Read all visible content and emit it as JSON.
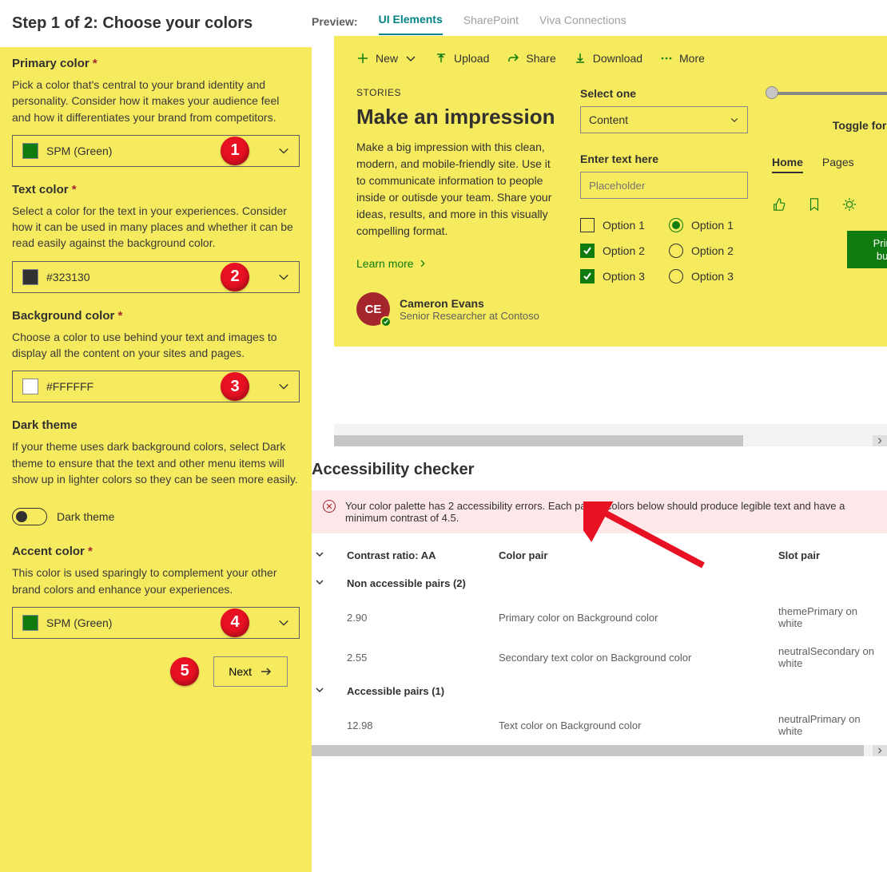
{
  "step_title": "Step 1 of 2: Choose your colors",
  "sections": {
    "primary": {
      "heading": "Primary color",
      "desc": "Pick a color that's central to your brand identity and personality. Consider how it makes your audience feel and how it differentiates your brand from competitors.",
      "value": "SPM (Green)",
      "swatch": "#107c10",
      "badge": "1"
    },
    "text": {
      "heading": "Text color",
      "desc": "Select a color for the text in your experiences. Consider how it can be used in many places and whether it can be read easily against the background color.",
      "value": "#323130",
      "swatch": "#323130",
      "badge": "2"
    },
    "background": {
      "heading": "Background color",
      "desc": "Choose a color to use behind your text and images to display all the content on your sites and pages.",
      "value": "#FFFFFF",
      "swatch": "#ffffff",
      "badge": "3"
    },
    "dark": {
      "heading": "Dark theme",
      "desc": "If your theme uses dark background colors, select Dark theme to ensure that the text and other menu items will show up in lighter colors so they can be seen more easily.",
      "toggle_label": "Dark theme"
    },
    "accent": {
      "heading": "Accent color",
      "desc": "This color is used sparingly to complement your other brand colors and enhance your experiences.",
      "value": "SPM (Green)",
      "swatch": "#107c10",
      "badge": "4"
    }
  },
  "next": {
    "label": "Next",
    "badge": "5"
  },
  "preview": {
    "label": "Preview:",
    "tabs": [
      "UI Elements",
      "SharePoint",
      "Viva Connections"
    ],
    "active_tab": 0,
    "cmd": {
      "new": "New",
      "upload": "Upload",
      "share": "Share",
      "download": "Download",
      "more": "More"
    },
    "stories": "STORIES",
    "impression_title": "Make an impression",
    "impression_body": "Make a big impression with this clean, modern, and mobile-friendly site. Use it to communicate information to people inside or outisde your team. Share your ideas, results, and more in this visually compelling format.",
    "learn_more": "Learn more",
    "persona": {
      "initials": "CE",
      "name": "Cameron Evans",
      "role": "Senior Researcher at Contoso"
    },
    "select_label": "Select one",
    "select_value": "Content",
    "enter_label": "Enter text here",
    "placeholder": "Placeholder",
    "checks": [
      "Option 1",
      "Option 2",
      "Option 3"
    ],
    "check_states": [
      false,
      true,
      true
    ],
    "radios": [
      "Option 1",
      "Option 2",
      "Option 3"
    ],
    "radio_selected": 0,
    "toggle_disabled": "Toggle for disabled",
    "pv_tabs": [
      "Home",
      "Pages"
    ],
    "primary_button": "Primary button"
  },
  "a11y": {
    "title": "Accessibility checker",
    "banner": "Your color palette has 2 accessibility errors. Each pair of colors below should produce legible text and have a minimum contrast of 4.5.",
    "headers": {
      "ratio": "Contrast ratio: AA",
      "pair": "Color pair",
      "slot": "Slot pair"
    },
    "groups": {
      "bad": "Non accessible pairs (2)",
      "good": "Accessible pairs (1)"
    },
    "rows_bad": [
      {
        "ratio": "2.90",
        "pair": "Primary color on Background color",
        "slot": "themePrimary on white"
      },
      {
        "ratio": "2.55",
        "pair": "Secondary text color on Background color",
        "slot": "neutralSecondary on white"
      }
    ],
    "rows_good": [
      {
        "ratio": "12.98",
        "pair": "Text color on Background color",
        "slot": "neutralPrimary on white"
      }
    ]
  }
}
